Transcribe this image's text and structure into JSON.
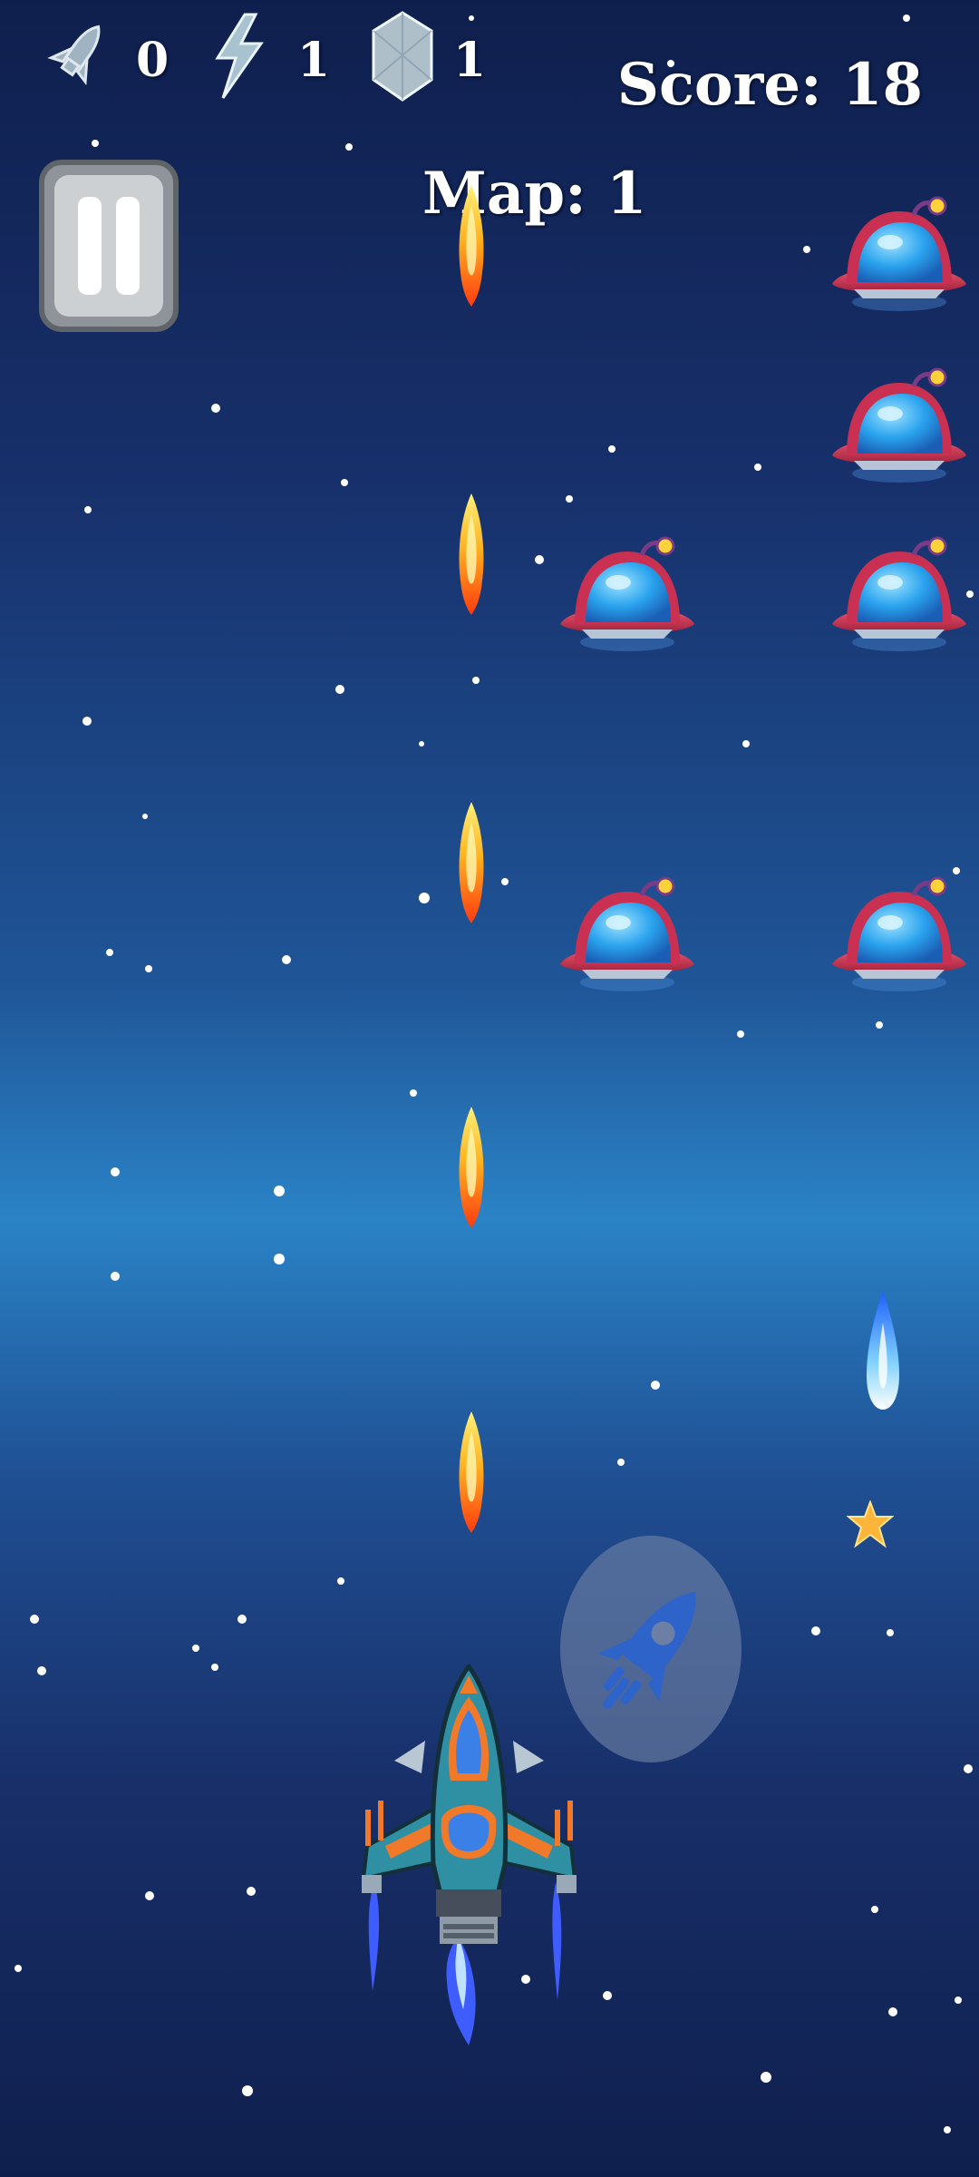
{
  "hud": {
    "missiles": {
      "icon": "missile-icon",
      "count": "0"
    },
    "lightning": {
      "icon": "lightning-icon",
      "count": "1"
    },
    "shield": {
      "icon": "crystal-shield-icon",
      "count": "1"
    },
    "score_text": "Score: 18",
    "map_text": "Map: 1"
  },
  "controls": {
    "pause_icon": "pause-icon",
    "fire_icon": "rocket-icon"
  },
  "colors": {
    "space_dark": "#0f1f4d",
    "space_glow": "#2a83c6",
    "enemy_hull": "#d33a57",
    "enemy_dome": "#2aa3ee",
    "bullet_core": "#ffd84a",
    "bullet_edge": "#ff3d12",
    "player_hull": "#2f8fa3",
    "player_accent": "#f07a2a",
    "thruster": "#3f5dff"
  }
}
